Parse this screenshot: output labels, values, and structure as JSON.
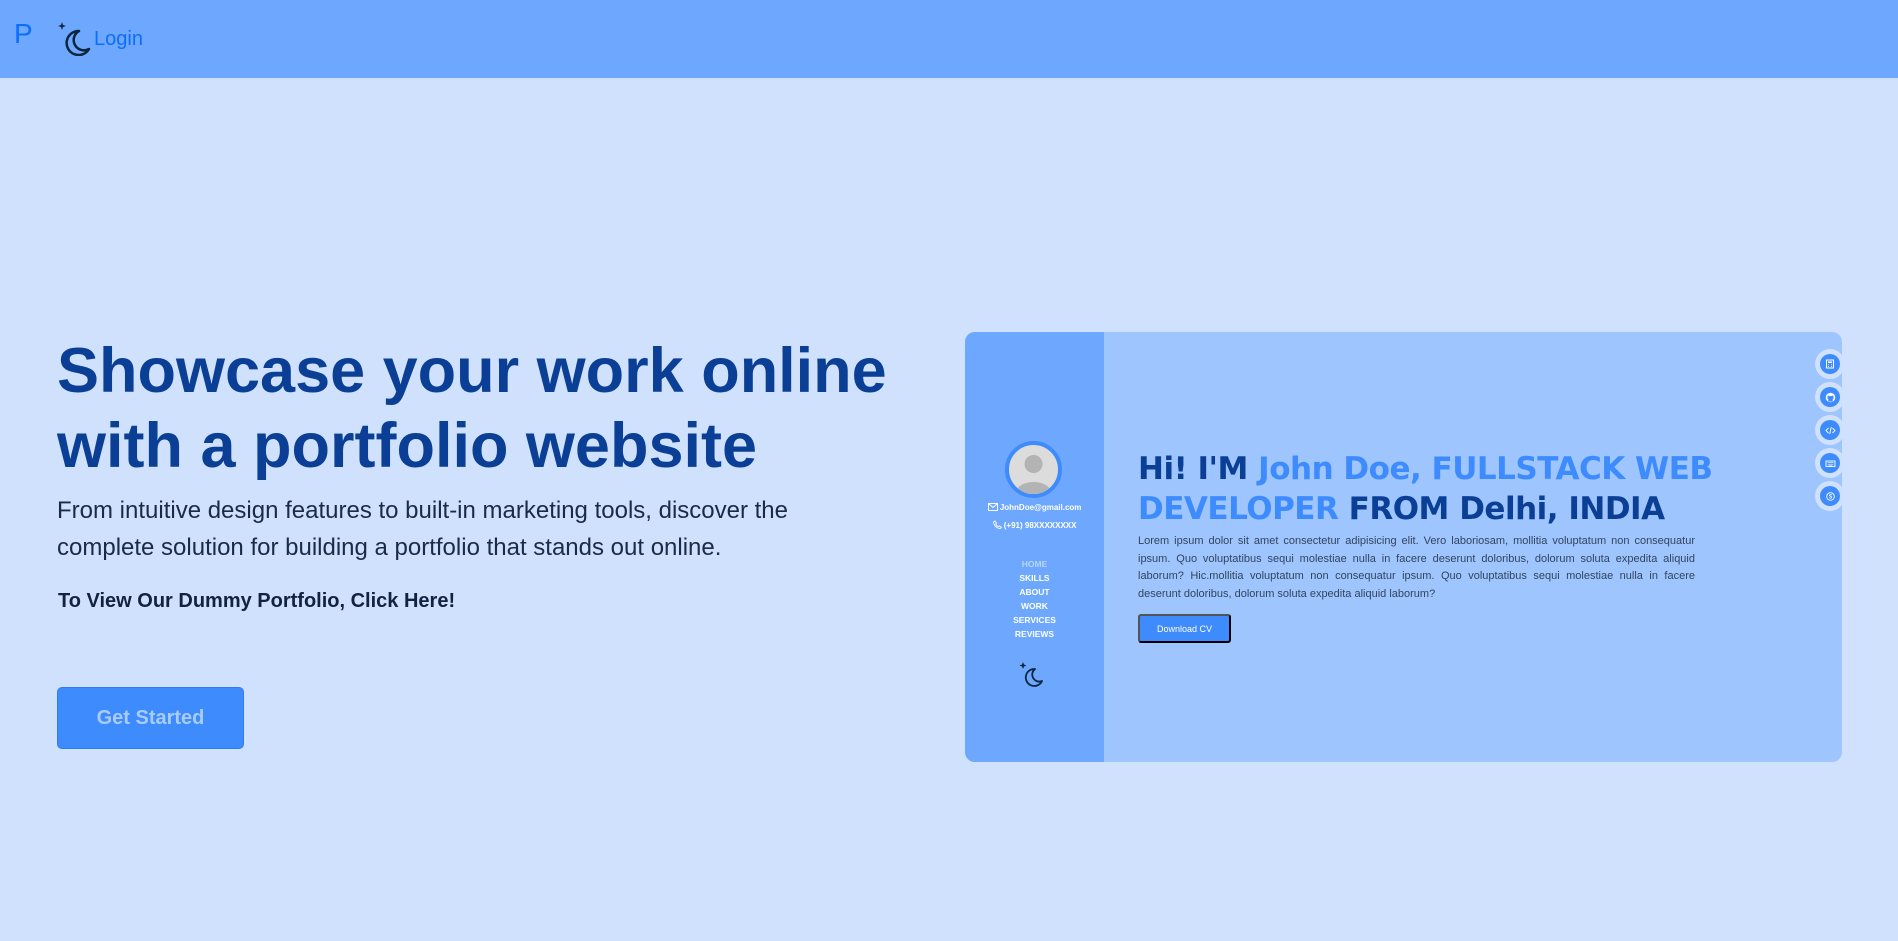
{
  "nav": {
    "logo": "P",
    "login_label": "Login"
  },
  "hero": {
    "title": "Showcase your work online with a portfolio website",
    "description": "From intuitive design features to built-in marketing tools, discover the complete solution for building a portfolio that stands out online.",
    "cta_link": "To View Our Dummy Portfolio, Click Here!",
    "get_started_label": "Get Started"
  },
  "preview": {
    "email": "JohnDoe@gmail.com",
    "phone": "(+91) 98XXXXXXXX",
    "nav_items": [
      "HOME",
      "SKILLS",
      "ABOUT",
      "WORK",
      "SERVICES",
      "REVIEWS"
    ],
    "heading_prefix": "Hi! I'M",
    "heading_highlight": "John Doe, FULLSTACK WEB DEVELOPER",
    "heading_suffix": "FROM Delhi, INDIA",
    "body": "Lorem ipsum dolor sit amet consectetur adipisicing elit. Vero laboriosam, mollitia voluptatum non consequatur ipsum. Quo voluptatibus sequi molestiae nulla in facere deserunt doloribus, dolorum soluta expedita aliquid laborum? Hic.mollitia voluptatum non consequatur ipsum. Quo voluptatibus sequi molestiae nulla in facere deserunt doloribus, dolorum soluta expedita aliquid laborum?",
    "download_label": "Download CV",
    "social_icons": [
      "calculator-icon",
      "github-icon",
      "code-icon",
      "keyboard-icon",
      "skype-icon"
    ]
  },
  "colors": {
    "topbar": "#6ea8fe",
    "background": "#cfe1fd",
    "title": "#0a3f95",
    "accent": "#3d8bfd"
  }
}
